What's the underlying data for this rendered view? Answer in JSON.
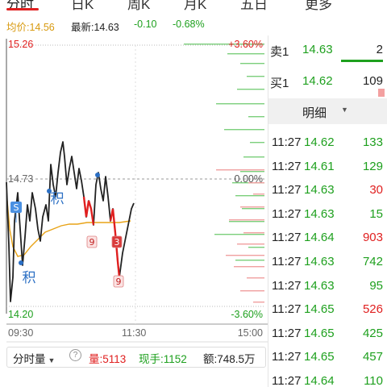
{
  "tabs": [
    {
      "label": "分时",
      "active": true
    },
    {
      "label": "日K",
      "active": false
    },
    {
      "label": "周K",
      "active": false
    },
    {
      "label": "月K",
      "active": false
    },
    {
      "label": "五日",
      "active": false
    },
    {
      "label": "更多",
      "active": false
    }
  ],
  "info": {
    "avg_label": "均价:14.56",
    "latest_label": "最新:14.63",
    "change": "-0.10",
    "change_pct": "-0.68%"
  },
  "chart": {
    "price_high": "15.26",
    "price_ref": "14.73",
    "price_low": "14.20",
    "pct_high": "+3.60%",
    "pct_zero": "0.00%",
    "pct_low": "-3.60%",
    "time_start": "09:30",
    "time_mid": "11:30",
    "time_end": "15:00",
    "markers": [
      {
        "type": "S",
        "label": "S"
      },
      {
        "type": "ji",
        "label": "积"
      },
      {
        "type": "ji",
        "label": "积"
      },
      {
        "type": "nine",
        "label": "9"
      },
      {
        "type": "nine",
        "label": "9"
      },
      {
        "type": "three",
        "label": "3"
      },
      {
        "type": "nine",
        "label": "9"
      }
    ],
    "colors": {
      "up": "#e02020",
      "down": "#1ea01e",
      "avg": "#e8a317",
      "price": "#222222",
      "blue": "#2b6fc4"
    }
  },
  "bottombar": {
    "indicator": "分时量",
    "help_icon": "help-circle-icon",
    "volume": "量:5113",
    "current_hand": "现手:1152",
    "amount": "额:748.5万"
  },
  "orderbook": [
    {
      "side": "卖1",
      "price": "14.63",
      "qty": "2"
    },
    {
      "side": "买1",
      "price": "14.62",
      "qty": "109"
    }
  ],
  "detail": {
    "label": "明细",
    "icon": "caret-down-icon"
  },
  "trades": [
    {
      "time": "11:27",
      "price": "14.62",
      "qty": "133",
      "dir": "down"
    },
    {
      "time": "11:27",
      "price": "14.61",
      "qty": "129",
      "dir": "down"
    },
    {
      "time": "11:27",
      "price": "14.63",
      "qty": "30",
      "dir": "up"
    },
    {
      "time": "11:27",
      "price": "14.63",
      "qty": "15",
      "dir": "down"
    },
    {
      "time": "11:27",
      "price": "14.64",
      "qty": "903",
      "dir": "up"
    },
    {
      "time": "11:27",
      "price": "14.63",
      "qty": "742",
      "dir": "down"
    },
    {
      "time": "11:27",
      "price": "14.63",
      "qty": "95",
      "dir": "down"
    },
    {
      "time": "11:27",
      "price": "14.65",
      "qty": "526",
      "dir": "up"
    },
    {
      "time": "11:27",
      "price": "14.65",
      "qty": "425",
      "dir": "down"
    },
    {
      "time": "11:27",
      "price": "14.65",
      "qty": "457",
      "dir": "down"
    },
    {
      "time": "11:27",
      "price": "14.64",
      "qty": "110",
      "dir": "down"
    }
  ]
}
